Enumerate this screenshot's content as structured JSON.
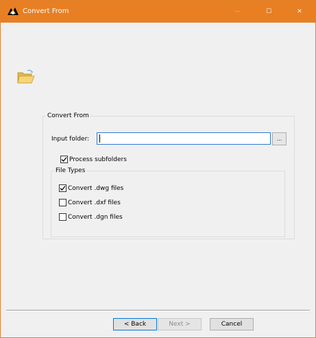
{
  "window": {
    "title": "Convert From",
    "controls": {
      "minimize": "—",
      "maximize": "☐",
      "close": "✕"
    },
    "accent_color": "#e87f23"
  },
  "group": {
    "legend": "Convert From",
    "input_label": "Input folder:",
    "input_value": "",
    "browse_label": "...",
    "process_subfolders": {
      "label": "Process subfolders",
      "checked": true
    }
  },
  "file_types": {
    "legend": "File Types",
    "options": [
      {
        "label": "Convert .dwg files",
        "checked": true
      },
      {
        "label": "Convert .dxf files",
        "checked": false
      },
      {
        "label": "Convert .dgn files",
        "checked": false
      }
    ]
  },
  "footer": {
    "back_label": "< Back",
    "next_label": "Next >",
    "cancel_label": "Cancel"
  },
  "icons": {
    "title": "app-logo-icon",
    "folder": "open-folder-icon",
    "check": "checkmark-icon"
  }
}
